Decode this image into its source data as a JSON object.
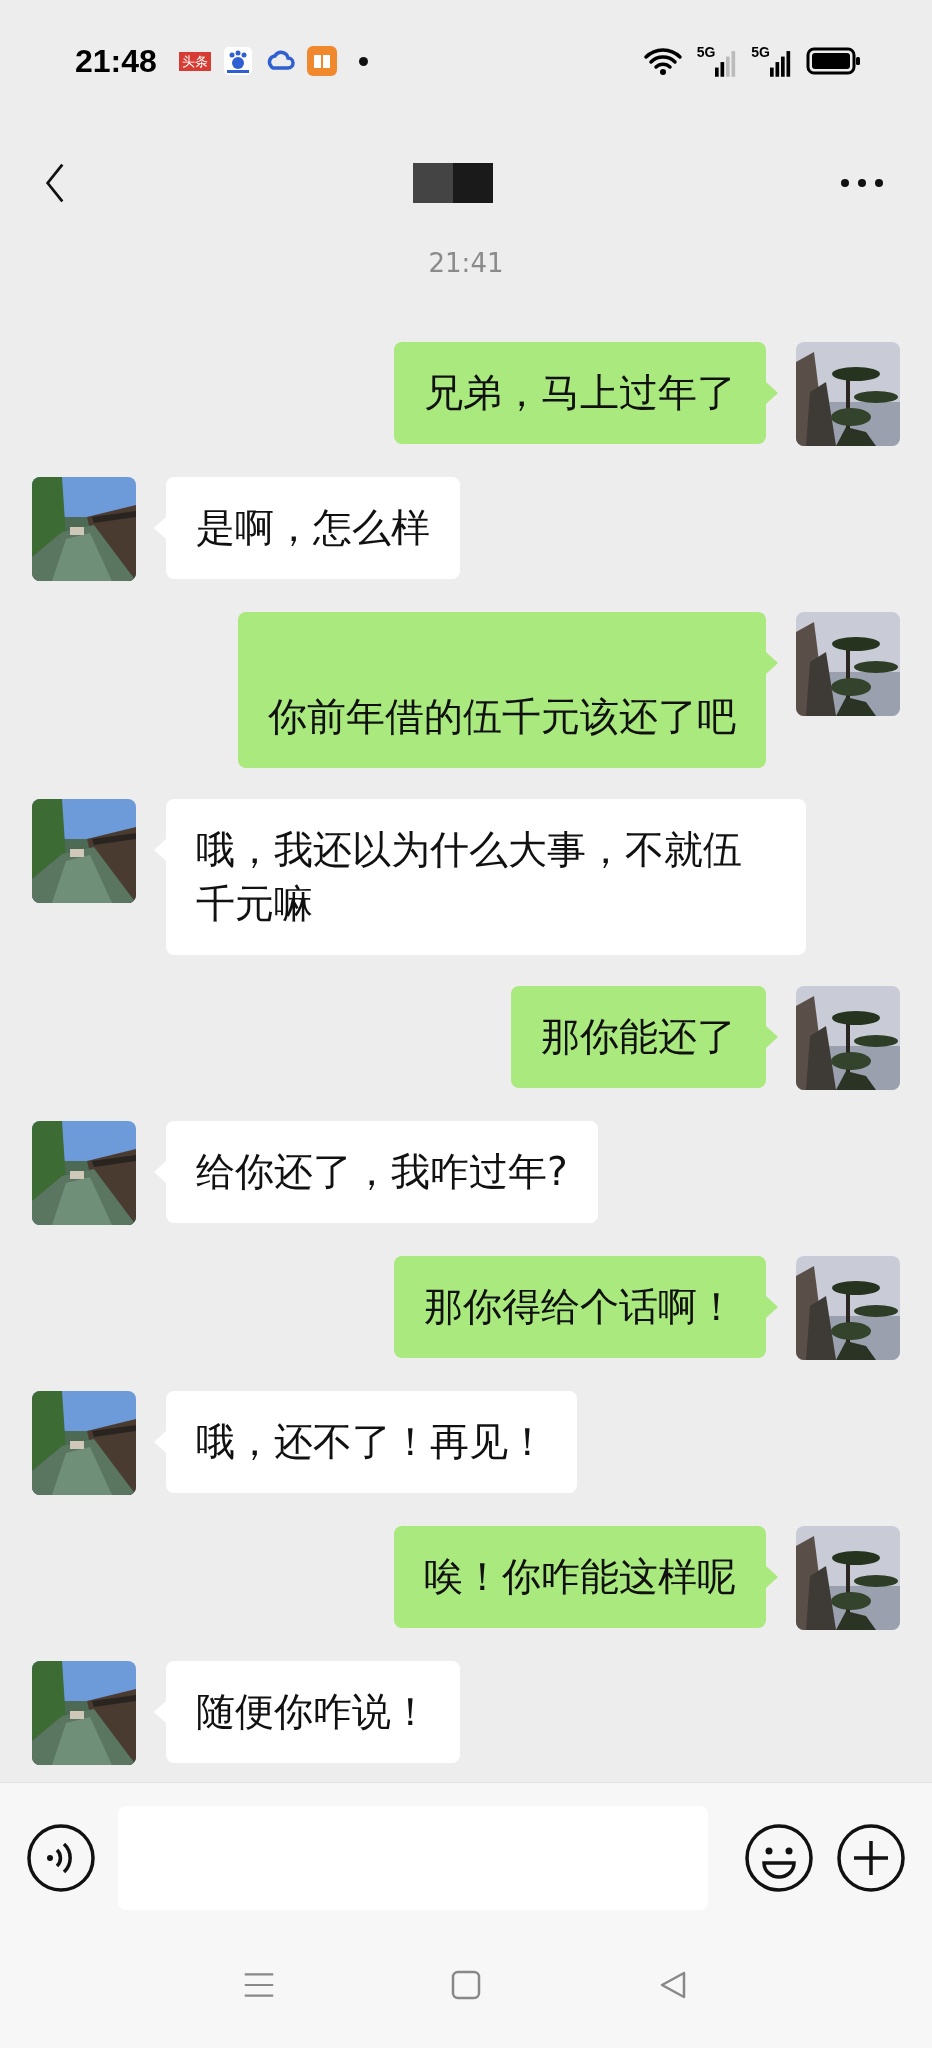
{
  "status_bar": {
    "time": "21:48",
    "notifications": [
      {
        "kind": "news",
        "text": "头条"
      },
      {
        "kind": "paw"
      },
      {
        "kind": "cloud"
      },
      {
        "kind": "book"
      }
    ],
    "networks": [
      {
        "label": "5G"
      },
      {
        "label": "5G"
      }
    ]
  },
  "timestamp": "21:41",
  "messages": [
    {
      "kind": "sent",
      "text": "兄弟，马上过年了"
    },
    {
      "kind": "received",
      "text": "是啊，怎么样"
    },
    {
      "kind": "sent",
      "text": "\n你前年借的伍千元该还了吧"
    },
    {
      "kind": "received",
      "text": "哦，我还以为什么大事，不就伍千元嘛"
    },
    {
      "kind": "sent",
      "text": "那你能还了"
    },
    {
      "kind": "received",
      "text": "给你还了，我咋过年?"
    },
    {
      "kind": "sent",
      "text": "那你得给个话啊！"
    },
    {
      "kind": "received",
      "text": "哦，还不了！再见！"
    },
    {
      "kind": "sent",
      "text": "唉！你咋能这样呢"
    },
    {
      "kind": "received",
      "text": "随便你咋说！"
    }
  ]
}
